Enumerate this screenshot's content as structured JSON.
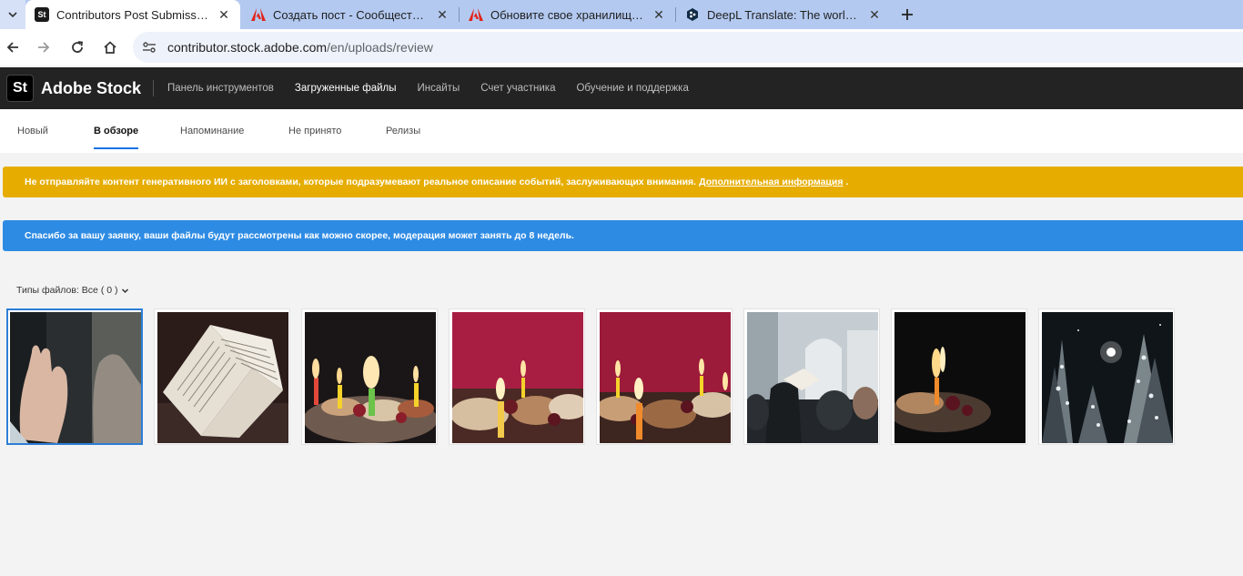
{
  "browser": {
    "tabs": [
      {
        "title": "Contributors Post Submission - ",
        "favicon": "adobe-stock-icon",
        "active": true
      },
      {
        "title": "Создать пост - Сообщество Ad",
        "favicon": "adobe-icon",
        "active": false
      },
      {
        "title": "Обновите свое хранилище Cre",
        "favicon": "adobe-icon",
        "active": false
      },
      {
        "title": "DeepL Translate: The world's mo",
        "favicon": "deepl-icon",
        "active": false
      }
    ],
    "url_host": "contributor.stock.adobe.com",
    "url_path": "/en/uploads/review"
  },
  "site": {
    "logo_badge": "St",
    "logo_text": "Adobe Stock",
    "nav": [
      {
        "label": "Панель инструментов",
        "active": false
      },
      {
        "label": "Загруженные файлы",
        "active": true
      },
      {
        "label": "Инсайты",
        "active": false
      },
      {
        "label": "Счет участника",
        "active": false
      },
      {
        "label": "Обучение и поддержка",
        "active": false
      }
    ]
  },
  "subtabs": [
    {
      "label": "Новый",
      "active": false
    },
    {
      "label": "В обзоре",
      "active": true
    },
    {
      "label": "Напоминание",
      "active": false
    },
    {
      "label": "Не принято",
      "active": false
    },
    {
      "label": "Релизы",
      "active": false
    }
  ],
  "banners": {
    "warning_text": "Не отправляйте контент генеративного ИИ с заголовками, которые подразумевают реальное описание событий, заслуживающих внимания.",
    "warning_link": "Дополнительная информация",
    "warning_suffix": ".",
    "info_text": "Спасибо за вашу заявку, ваши файлы будут рассмотрены как можно скорее, модерация может занять до 8 недель."
  },
  "filter": {
    "label": "Типы файлов: Все ( 0 )"
  },
  "colors": {
    "warning": "#e6ad00",
    "info": "#2d8be4",
    "accent": "#1473e6",
    "header": "#232323"
  },
  "thumbnails": [
    {
      "name": "praying-hands",
      "selected": true
    },
    {
      "name": "open-book",
      "selected": false
    },
    {
      "name": "candles-dessert-dark",
      "selected": false
    },
    {
      "name": "candles-dessert-red",
      "selected": false
    },
    {
      "name": "candles-dessert-red-2",
      "selected": false
    },
    {
      "name": "crowd-blurred",
      "selected": false
    },
    {
      "name": "single-candle-dark",
      "selected": false
    },
    {
      "name": "snowy-trees-night",
      "selected": false
    }
  ]
}
